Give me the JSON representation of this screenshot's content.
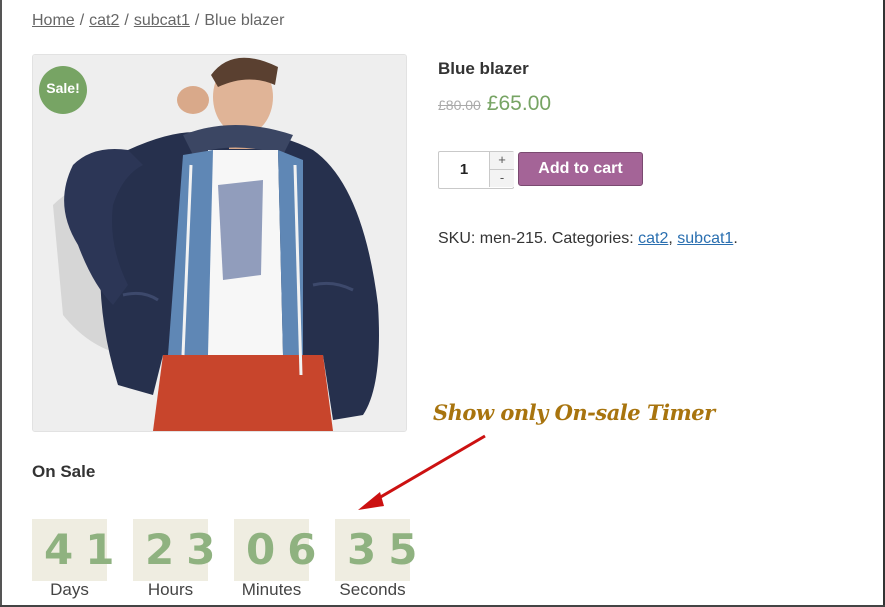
{
  "breadcrumb": {
    "home": "Home",
    "cat": "cat2",
    "subcat": "subcat1",
    "current": "Blue blazer",
    "separator": "/"
  },
  "product": {
    "sale_badge": "Sale!",
    "title": "Blue blazer",
    "old_price": "£80.00",
    "new_price": "£65.00",
    "quantity": "1",
    "qty_plus": "+",
    "qty_minus": "-",
    "add_to_cart": "Add to cart",
    "sku_label": "SKU:",
    "sku": "men-215",
    "categories_label": "Categories:",
    "categories": [
      "cat2",
      "subcat1"
    ]
  },
  "annotation": "Show only On-sale Timer",
  "countdown": {
    "heading": "On Sale",
    "units": [
      {
        "value": "41",
        "label": "Days"
      },
      {
        "value": "23",
        "label": "Hours"
      },
      {
        "value": "06",
        "label": "Minutes"
      },
      {
        "value": "35",
        "label": "Seconds"
      }
    ]
  },
  "colors": {
    "sale_green": "#77a464",
    "button_purple": "#a46497",
    "link_blue": "#2a6fb0",
    "annotation_gold": "#a8740e",
    "arrow_red": "#cc1111",
    "timer_bg": "#efede1",
    "timer_digit": "#8fb280"
  }
}
